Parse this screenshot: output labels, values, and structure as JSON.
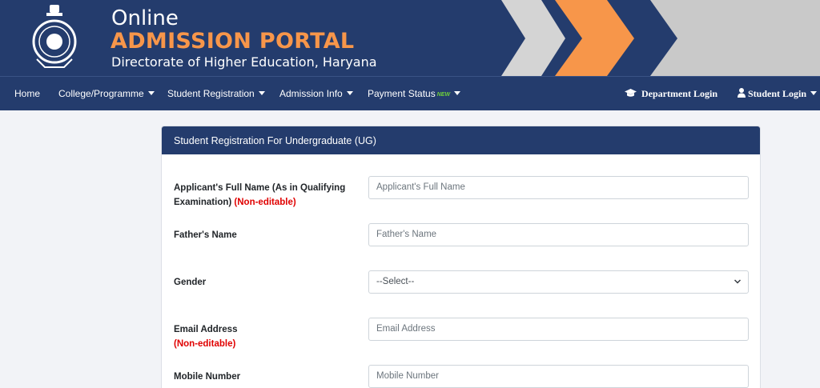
{
  "header": {
    "title_line1": "Online",
    "title_line2": "ADMISSION PORTAL",
    "subtitle": "Directorate of Higher Education, Haryana"
  },
  "nav": {
    "items": [
      {
        "label": "Home"
      },
      {
        "label": "College/Programme"
      },
      {
        "label": "Student Registration"
      },
      {
        "label": "Admission Info"
      },
      {
        "label": "Payment Status",
        "badge": "NEW"
      }
    ],
    "department_login": "Department Login",
    "student_login": "Student Login"
  },
  "form": {
    "title": "Student Registration For Undergraduate (UG)",
    "fields": [
      {
        "label": "Applicant's Full Name (As in Qualifying Examination)",
        "note": "(Non-editable)",
        "placeholder": "Applicant's Full Name"
      },
      {
        "label": "Father's Name",
        "note": "",
        "placeholder": "Father's Name"
      },
      {
        "label": "Gender",
        "note": "",
        "value": "--Select--"
      },
      {
        "label": "Email Address",
        "note": "(Non-editable)",
        "placeholder": "Email Address"
      },
      {
        "label": "Mobile Number",
        "note": "",
        "placeholder": "Mobile Number"
      }
    ]
  },
  "colors": {
    "primary": "#243c6d",
    "accent_orange": "#f7964a",
    "chevron_gray": "#c9c9c9",
    "required_red": "#e00000"
  },
  "icons": [
    "emblem-logo",
    "graduation-cap-icon",
    "user-icon",
    "caret-down-icon",
    "select-chevron-icon"
  ]
}
